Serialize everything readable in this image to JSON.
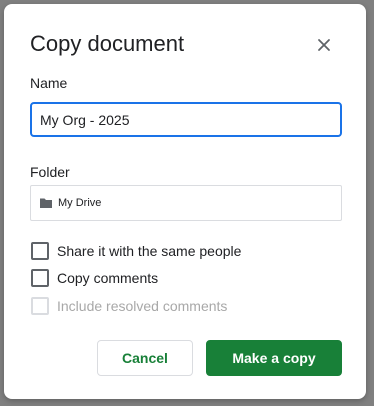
{
  "dialog": {
    "title": "Copy document",
    "close_icon": "close-icon"
  },
  "name_field": {
    "label": "Name",
    "value": "My Org - 2025"
  },
  "folder_field": {
    "label": "Folder",
    "icon": "folder-icon",
    "value": "My Drive"
  },
  "options": [
    {
      "label": "Share it with the same people",
      "checked": false,
      "disabled": false
    },
    {
      "label": "Copy comments",
      "checked": false,
      "disabled": false
    },
    {
      "label": "Include resolved comments",
      "checked": false,
      "disabled": true
    }
  ],
  "buttons": {
    "cancel_label": "Cancel",
    "confirm_label": "Make a copy"
  },
  "colors": {
    "accent_green": "#188038",
    "focus_blue": "#1a73e8",
    "overlay": "#808080"
  }
}
